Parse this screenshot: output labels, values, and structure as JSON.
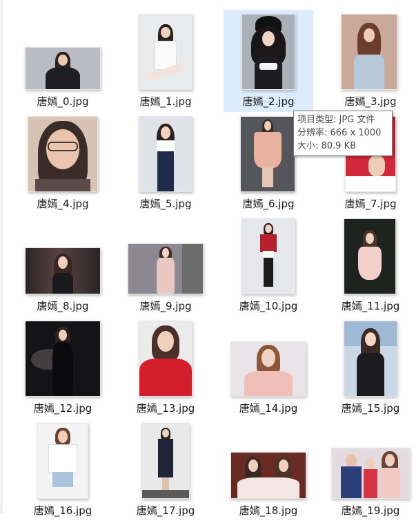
{
  "files": [
    {
      "name": "唐嫣_0.jpg"
    },
    {
      "name": "唐嫣_1.jpg"
    },
    {
      "name": "唐嫣_2.jpg"
    },
    {
      "name": "唐嫣_3.jpg"
    },
    {
      "name": "唐嫣_4.jpg"
    },
    {
      "name": "唐嫣_5.jpg"
    },
    {
      "name": "唐嫣_6.jpg"
    },
    {
      "name": "唐嫣_7.jpg"
    },
    {
      "name": "唐嫣_8.jpg"
    },
    {
      "name": "唐嫣_9.jpg"
    },
    {
      "name": "唐嫣_10.jpg"
    },
    {
      "name": "唐嫣_11.jpg"
    },
    {
      "name": "唐嫣_12.jpg"
    },
    {
      "name": "唐嫣_13.jpg"
    },
    {
      "name": "唐嫣_14.jpg"
    },
    {
      "name": "唐嫣_15.jpg"
    },
    {
      "name": "唐嫣_16.jpg"
    },
    {
      "name": "唐嫣_17.jpg"
    },
    {
      "name": "唐嫣_18.jpg"
    },
    {
      "name": "唐嫣_19.jpg"
    }
  ],
  "tooltip": {
    "type_line": "项目类型: JPG 文件",
    "resolution_line": "分辨率: 666 x 1000",
    "size_line": "大小: 80.9 KB"
  }
}
